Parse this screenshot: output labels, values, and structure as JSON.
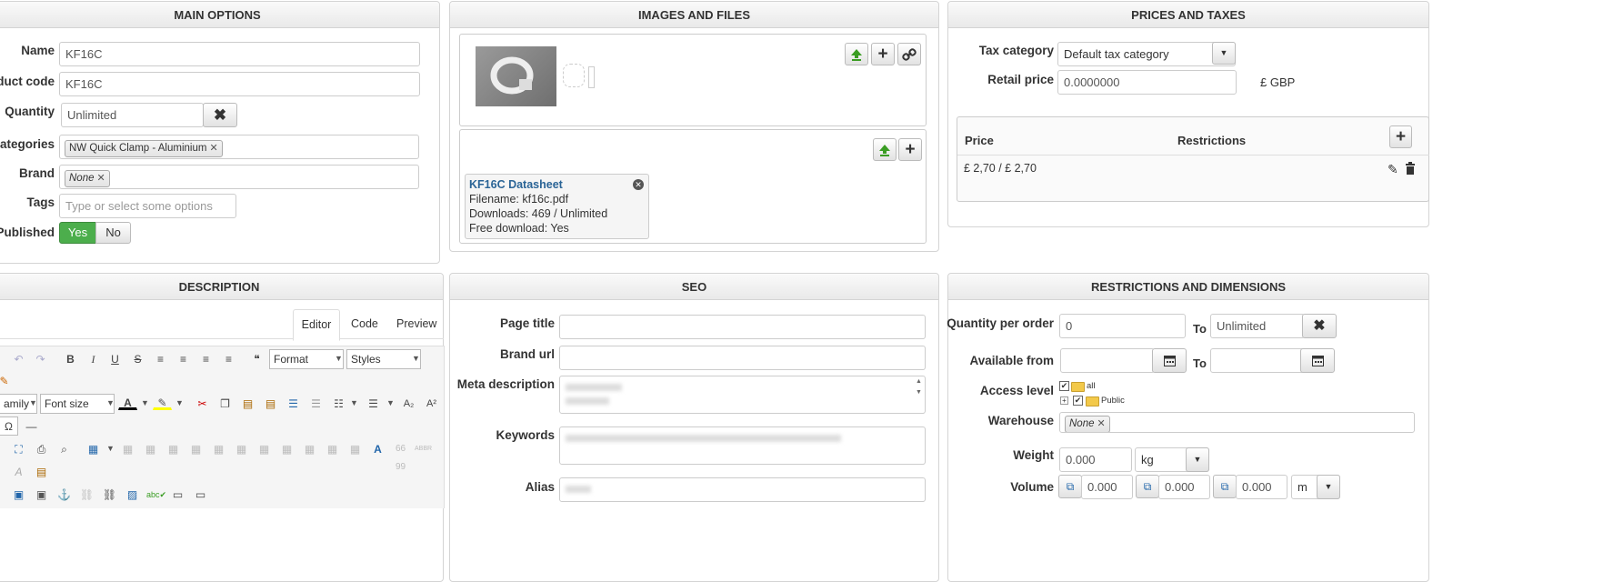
{
  "main_options": {
    "title": "MAIN OPTIONS",
    "name_label": "Name",
    "name_value": "KF16C",
    "product_code_label": "oduct code",
    "product_code_value": "KF16C",
    "quantity_label": "Quantity",
    "quantity_value": "Unlimited",
    "categories_label": "Categories",
    "category_tag": "NW Quick Clamp - Aluminium",
    "brand_label": "Brand",
    "brand_tag": "None",
    "tags_label": "Tags",
    "tags_placeholder": "Type or select some options",
    "published_label": "Published",
    "yes_label": "Yes",
    "no_label": "No"
  },
  "images_files": {
    "title": "IMAGES AND FILES",
    "file_title": "KF16C Datasheet",
    "file_name": "Filename: kf16c.pdf",
    "file_downloads": "Downloads: 469 / Unlimited",
    "file_free": "Free download: Yes"
  },
  "prices": {
    "title": "PRICES AND TAXES",
    "tax_label": "Tax category",
    "tax_value": "Default tax category",
    "retail_label": "Retail price",
    "retail_value": "0.0000000",
    "currency": "£ GBP",
    "col_price": "Price",
    "col_restrictions": "Restrictions",
    "row_price": "£ 2,70 / £ 2,70"
  },
  "description": {
    "title": "DESCRIPTION",
    "tabs": [
      "Editor",
      "Code",
      "Preview"
    ],
    "format_label": "Format",
    "styles_label": "Styles",
    "font_family_label": "amily",
    "font_size_label": "Font size"
  },
  "seo": {
    "title": "SEO",
    "page_title_label": "Page title",
    "brand_url_label": "Brand url",
    "meta_label": "Meta description",
    "keywords_label": "Keywords",
    "alias_label": "Alias"
  },
  "restrictions": {
    "title": "RESTRICTIONS AND DIMENSIONS",
    "qty_order_label": "Quantity per order",
    "qty_from": "0",
    "to_label": "To",
    "qty_to": "Unlimited",
    "available_label": "Available from",
    "access_label": "Access level",
    "access_all": "all",
    "access_public": "Public",
    "warehouse_label": "Warehouse",
    "warehouse_tag": "None",
    "weight_label": "Weight",
    "weight_value": "0.000",
    "weight_unit": "kg",
    "volume_label": "Volume",
    "vol_x": "0.000",
    "vol_y": "0.000",
    "vol_z": "0.000",
    "vol_unit": "m"
  },
  "colors": {
    "accent_green": "#4cae4c",
    "link_blue": "#2a6496"
  }
}
